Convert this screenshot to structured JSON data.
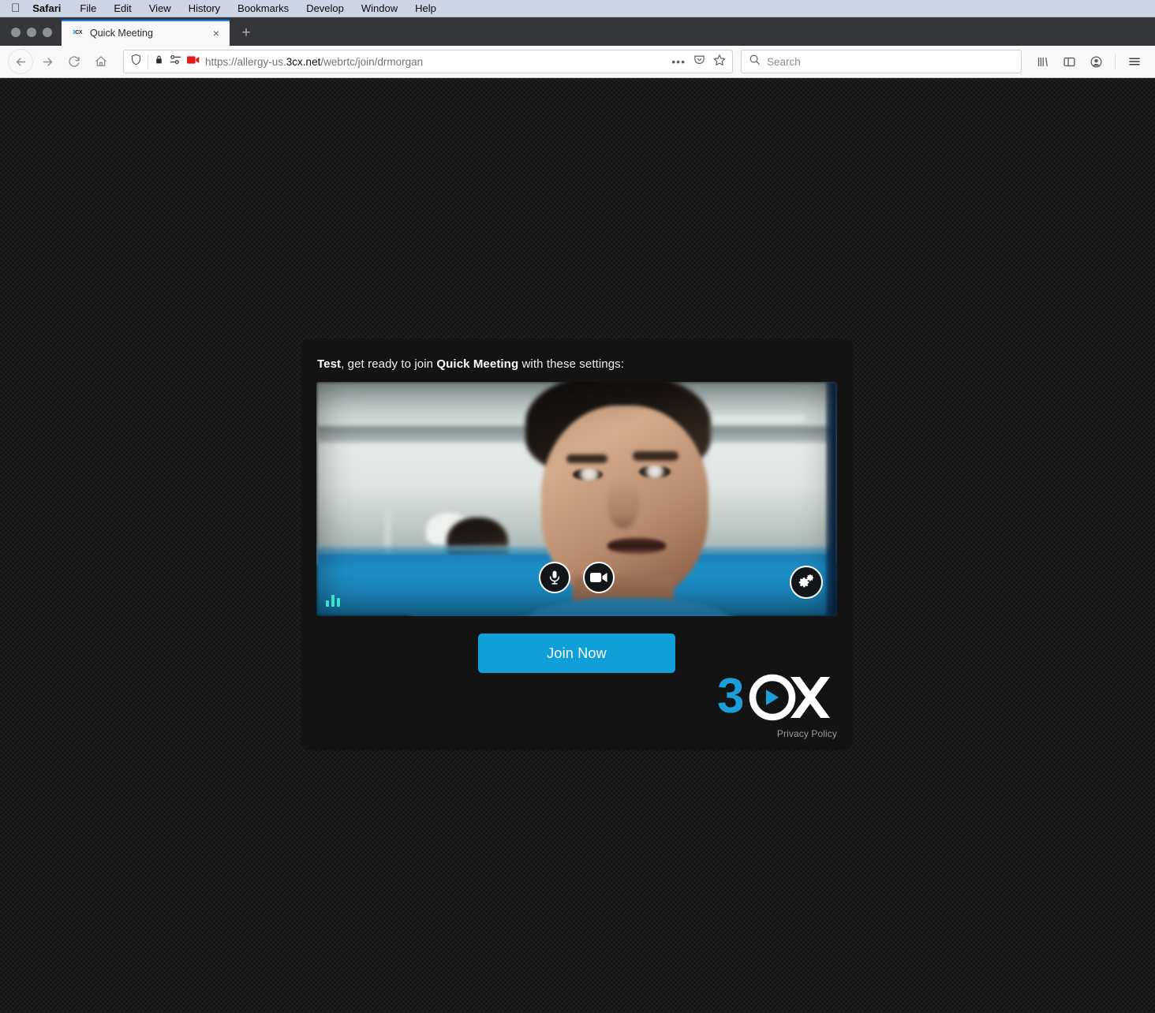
{
  "os_menubar": {
    "apple_icon": "apple-logo-icon",
    "items": [
      {
        "label": "Safari",
        "bold": true
      },
      {
        "label": "File",
        "bold": false
      },
      {
        "label": "Edit",
        "bold": false
      },
      {
        "label": "View",
        "bold": false
      },
      {
        "label": "History",
        "bold": false
      },
      {
        "label": "Bookmarks",
        "bold": false
      },
      {
        "label": "Develop",
        "bold": false
      },
      {
        "label": "Window",
        "bold": false
      },
      {
        "label": "Help",
        "bold": false
      }
    ]
  },
  "browser": {
    "window_controls": [
      "close",
      "minimize",
      "zoom"
    ],
    "tab": {
      "favicon_text_3": "3",
      "favicon_text_cx": "CX",
      "title": "Quick Meeting",
      "close_glyph": "×"
    },
    "new_tab_glyph": "+",
    "nav": {
      "back": "back-icon",
      "forward": "forward-icon",
      "reload": "reload-icon",
      "home": "home-icon"
    },
    "urlbar": {
      "shield_icon": "tracking-protection-shield-icon",
      "lock_icon": "padlock-icon",
      "permissions_icon": "site-permissions-icon",
      "camera_icon": "camera-sharing-icon",
      "url_prefix": "https://allergy-us.",
      "url_host": "3cx.net",
      "url_path": "/webrtc/join/drmorgan",
      "page_actions_glyph": "•••",
      "pocket_icon": "pocket-icon",
      "bookmark_icon": "star-bookmark-icon"
    },
    "search": {
      "icon": "search-icon",
      "placeholder": "Search"
    },
    "toolbar_right": {
      "library_icon": "library-icon",
      "sidebar_icon": "sidebar-icon",
      "account_icon": "account-icon",
      "menu_icon": "hamburger-menu-icon"
    }
  },
  "meeting": {
    "greeting_name": "Test",
    "greeting_middle": ", get ready to join ",
    "meeting_name": "Quick Meeting",
    "greeting_suffix": " with these settings:",
    "video": {
      "mic_icon": "microphone-icon",
      "camera_icon": "video-camera-icon",
      "settings_icon": "settings-gears-icon",
      "audio_level_icon": "audio-level-meter-icon"
    },
    "join_label": "Join Now",
    "privacy_label": "Privacy Policy",
    "logo": {
      "digit": "3",
      "letter_c": "C",
      "letter_x": "X"
    }
  },
  "colors": {
    "accent_blue": "#119fd9",
    "logo_blue": "#1a9fd9",
    "panel_bg": "#131313",
    "page_bg": "#191919",
    "audio_meter": "#3fe0c8"
  }
}
